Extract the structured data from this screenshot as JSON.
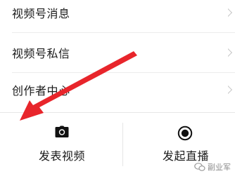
{
  "menu": {
    "items": [
      {
        "label": "视频号消息"
      },
      {
        "label": "视频号私信"
      },
      {
        "label": "创作者中心"
      }
    ]
  },
  "actions": {
    "post_video": {
      "label": "发表视频",
      "icon": "camera-icon"
    },
    "start_live": {
      "label": "发起直播",
      "icon": "live-record-icon"
    }
  },
  "annotation": {
    "color": "#e8252b"
  },
  "watermark": {
    "text": "副业军"
  }
}
